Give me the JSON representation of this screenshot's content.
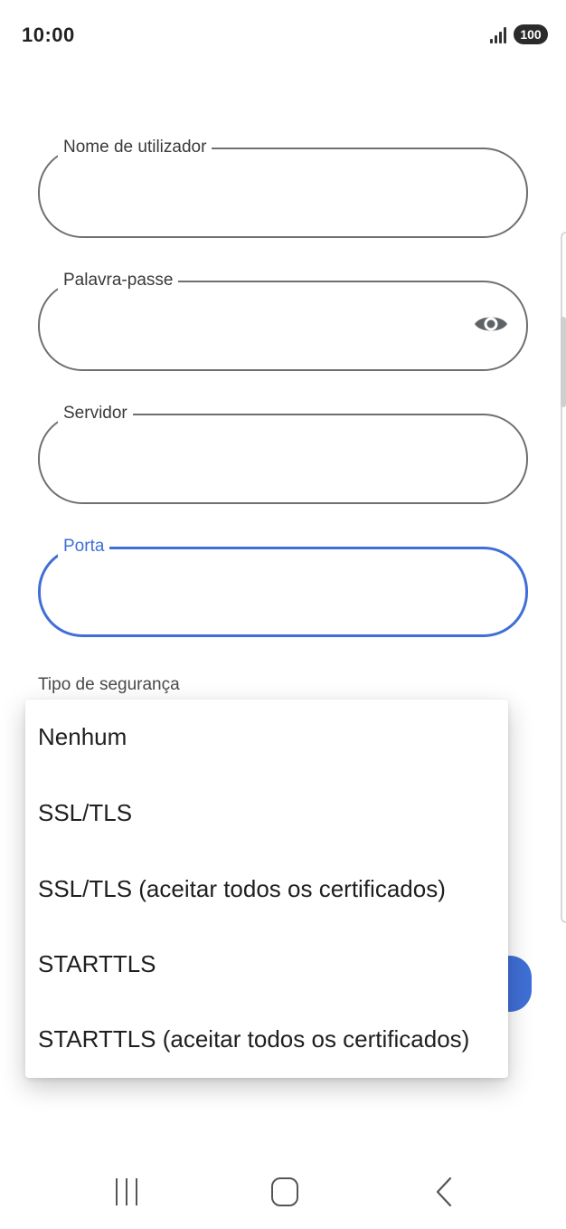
{
  "status_bar": {
    "time": "10:00",
    "battery": "100"
  },
  "form": {
    "username_label": "Nome de utilizador",
    "password_label": "Palavra-passe",
    "server_label": "Servidor",
    "port_label": "Porta",
    "security_type_label": "Tipo de segurança"
  },
  "dropdown": {
    "options": [
      "Nenhum",
      "SSL/TLS",
      "SSL/TLS (aceitar todos os certificados)",
      "STARTTLS",
      "STARTTLS (aceitar todos os certificados)"
    ]
  },
  "colors": {
    "accent": "#3f6fd6",
    "outline": "#6f6f6f"
  },
  "icons": {
    "password_toggle": "eye-icon",
    "nav_recents": "recents-icon",
    "nav_home": "home-icon",
    "nav_back": "back-icon"
  }
}
